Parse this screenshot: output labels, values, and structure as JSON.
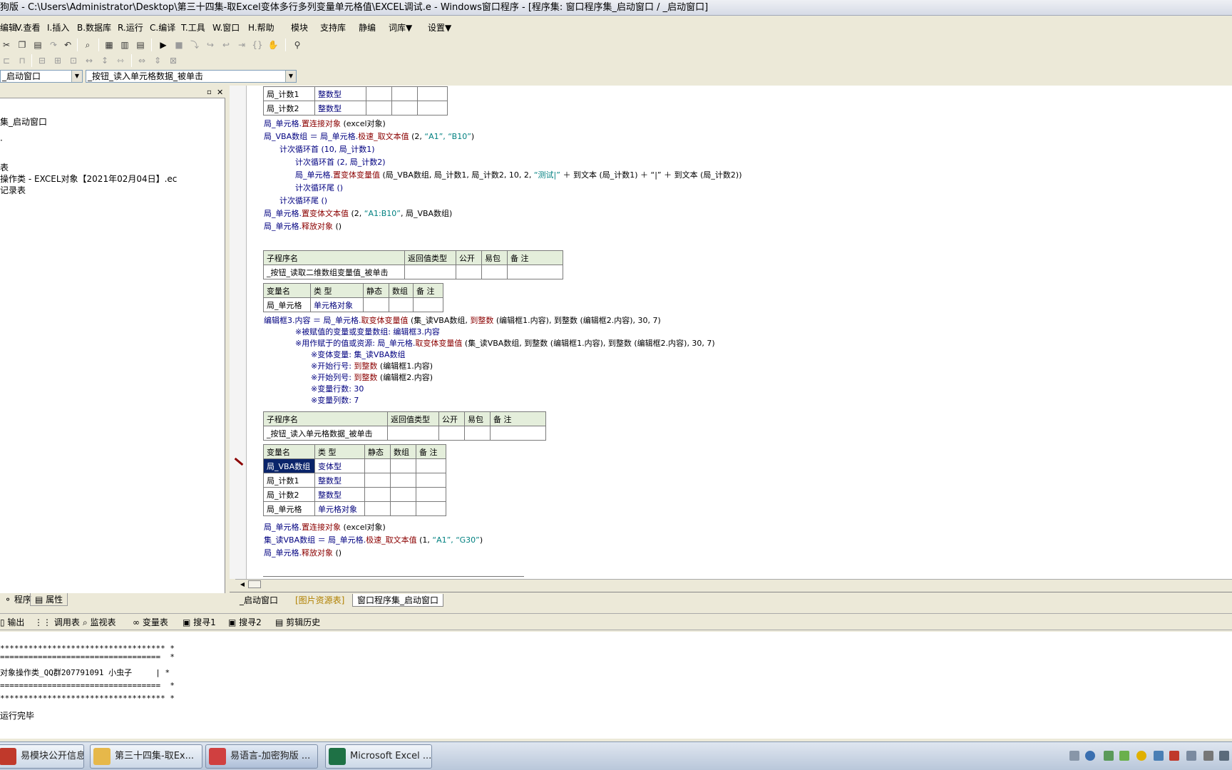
{
  "window": {
    "title": "狗版 - C:\\Users\\Administrator\\Desktop\\第三十四集-取Excel变体多行多列变量单元格值\\EXCEL调试.e - Windows窗口程序 - [程序集: 窗口程序集_启动窗口 / _启动窗口]"
  },
  "menu": {
    "items": [
      "编辑",
      "V.查看",
      "I.插入",
      "B.数据库",
      "R.运行",
      "C.编译",
      "T.工具",
      "W.窗口",
      "H.帮助",
      "模块",
      "支持库",
      "静编",
      "词库▼",
      "设置▼"
    ]
  },
  "combos": {
    "left": "_启动窗口",
    "right": "_按钮_读入单元格数据_被单击"
  },
  "left_tree": [
    "集_启动窗口",
    "·",
    "表",
    "操作类 - EXCEL对象【2021年02月04日】.ec",
    "记录表"
  ],
  "left_tabs": {
    "program": "程序",
    "property": "属性"
  },
  "editor": {
    "top_vars": [
      {
        "name": "局_计数1",
        "type": "整数型"
      },
      {
        "name": "局_计数2",
        "type": "整数型"
      }
    ],
    "code1": [
      {
        "a": "局_单元格.",
        "f": "置连接对象",
        "b": " (excel对象)"
      },
      {
        "a": "局_VBA数组 ＝ 局_单元格.",
        "f": "极速_取文本值",
        "b": " (2, ",
        "s": "“A1”, “B10”",
        "c": ")"
      },
      {
        "a": "计次循环首 (10, 局_计数1)"
      },
      {
        "a": "计次循环首 (2, 局_计数2)"
      },
      {
        "a": "局_单元格.",
        "f": "置变体变量值",
        "b": " (局_VBA数组, 局_计数1, 局_计数2, 10, 2, ",
        "s": "“测试|”",
        "c": " ＋ 到文本 (局_计数1) ＋ “|” ＋ 到文本 (局_计数2))"
      },
      {
        "a": "计次循环尾 ()"
      },
      {
        "a": "计次循环尾 ()"
      },
      {
        "a": "局_单元格.",
        "f": "置变体文本值",
        "b": " (2, ",
        "s": "“A1:B10”",
        "c": ", 局_VBA数组)"
      },
      {
        "a": "局_单元格.",
        "f": "释放对象",
        "b": " ()"
      }
    ],
    "sub1": {
      "headers": [
        "子程序名",
        "返回值类型",
        "公开",
        "易包",
        "备 注"
      ],
      "name": "_按钮_读取二维数组变量值_被单击"
    },
    "vars1": {
      "headers": [
        "变量名",
        "类 型",
        "静态",
        "数组",
        "备 注"
      ],
      "rows": [
        {
          "name": "局_单元格",
          "type": "单元格对象"
        }
      ]
    },
    "code2": [
      {
        "a": "编辑框3.内容 ＝ 局_单元格.",
        "f": "取变体变量值",
        "b": " (集_读VBA数组, ",
        "g": "到整数",
        "c": " (编辑框1.内容), 到整数 (编辑框2.内容), 30, 7)"
      },
      {
        "a": "※被赋值的变量或变量数组: 编辑框3.内容"
      },
      {
        "a": "※用作赋于的值或资源: 局_单元格.",
        "f": "取变体变量值",
        "b": " (集_读VBA数组, 到整数 (编辑框1.内容), 到整数 (编辑框2.内容), 30, 7)"
      },
      {
        "a": "※变体变量: 集_读VBA数组"
      },
      {
        "a": "※开始行号: ",
        "g": "到整数",
        "c": " (编辑框1.内容)"
      },
      {
        "a": "※开始列号: ",
        "g": "到整数",
        "c": " (编辑框2.内容)"
      },
      {
        "a": "※变量行数: 30"
      },
      {
        "a": "※变量列数: 7"
      }
    ],
    "sub2": {
      "headers": [
        "子程序名",
        "返回值类型",
        "公开",
        "易包",
        "备 注"
      ],
      "name": "_按钮_读入单元格数据_被单击"
    },
    "vars2": {
      "headers": [
        "变量名",
        "类 型",
        "静态",
        "数组",
        "备 注"
      ],
      "rows": [
        {
          "name": "局_VBA数组",
          "type": "变体型"
        },
        {
          "name": "局_计数1",
          "type": "整数型"
        },
        {
          "name": "局_计数2",
          "type": "整数型"
        },
        {
          "name": "局_单元格",
          "type": "单元格对象"
        }
      ]
    },
    "code3": [
      {
        "a": "局_单元格.",
        "f": "置连接对象",
        "b": " (excel对象)"
      },
      {
        "a": "集_读VBA数组 ＝ 局_单元格.",
        "f": "极速_取文本值",
        "b": " (1, ",
        "s": "“A1”, “G30”",
        "c": ")"
      },
      {
        "a": "局_单元格.",
        "f": "释放对象",
        "b": " ()"
      }
    ]
  },
  "bottom_tabs": [
    "_启动窗口",
    "[图片资源表]",
    "窗口程序集_启动窗口"
  ],
  "output_tabs": [
    "输出",
    "调用表",
    "监视表",
    "变量表",
    "搜寻1",
    "搜寻2",
    "剪辑历史"
  ],
  "output": {
    "l1": "*********************************** *",
    "l2": "==================================  *",
    "l3": "对象操作类_QQ群207791091 小虫子     | *",
    "l4": "==================================  *",
    "l5": "*********************************** *",
    "done": "运行完毕"
  },
  "taskbar": [
    {
      "label": "易模块公开信息 ...",
      "color": "#c0392b"
    },
    {
      "label": "第三十四集-取Ex...",
      "color": "#e6b84a"
    },
    {
      "label": "易语言-加密狗版 ...",
      "color": "#d04040"
    },
    {
      "label": "Microsoft Excel ...",
      "color": "#1e7145"
    }
  ]
}
